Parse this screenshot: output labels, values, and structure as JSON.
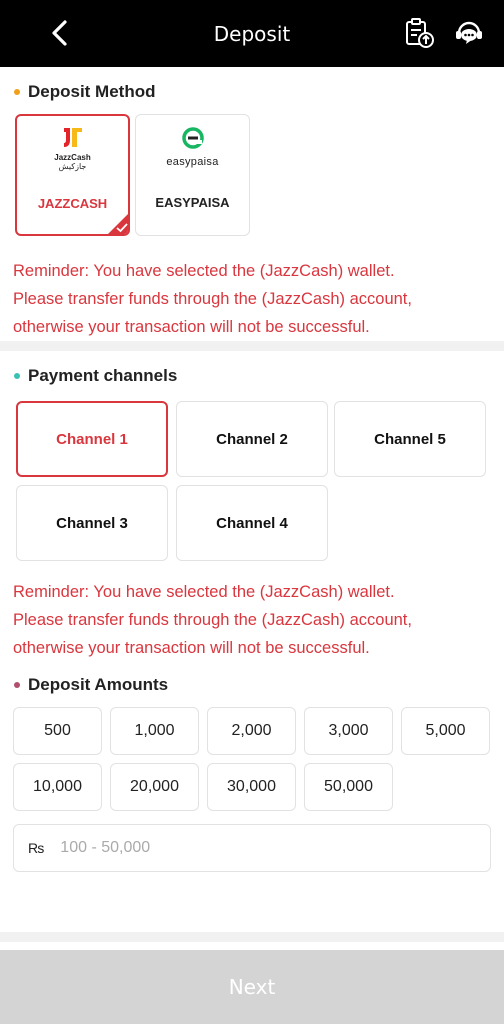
{
  "header": {
    "title": "Deposit"
  },
  "deposit_method": {
    "title": "Deposit Method",
    "dot_color": "#f0a019",
    "methods": [
      {
        "label": "JAZZCASH",
        "logo_text": "JazzCash",
        "logo_urdu": "جازکیش",
        "selected": true
      },
      {
        "label": "EASYPAISA",
        "logo_text": "easypaisa",
        "selected": false
      }
    ]
  },
  "reminder1": {
    "line1": "Reminder: You have selected the (JazzCash) wallet.",
    "line2": "Please transfer funds through the (JazzCash) account,",
    "line3": "otherwise your transaction will not be successful."
  },
  "payment_channels": {
    "title": "Payment channels",
    "dot_color": "#3cc0b4",
    "channels": [
      {
        "label": "Channel 1",
        "selected": true
      },
      {
        "label": "Channel 2",
        "selected": false
      },
      {
        "label": "Channel 5",
        "selected": false
      },
      {
        "label": "Channel 3",
        "selected": false
      },
      {
        "label": "Channel 4",
        "selected": false
      }
    ]
  },
  "reminder2": {
    "line1": "Reminder: You have selected the (JazzCash) wallet.",
    "line2": "Please transfer funds through the (JazzCash) account,",
    "line3": "otherwise your transaction will not be successful."
  },
  "deposit_amounts": {
    "title": "Deposit Amounts",
    "dot_color": "#b0506e",
    "amounts": [
      "500",
      "1,000",
      "2,000",
      "3,000",
      "5,000",
      "10,000",
      "20,000",
      "30,000",
      "50,000"
    ],
    "currency_symbol": "₨",
    "input_placeholder": "100 - 50,000",
    "input_value": ""
  },
  "next_button": {
    "label": "Next"
  },
  "colors": {
    "accent": "#d9363e",
    "header_bg": "#000000",
    "disabled_btn": "#d4d4d4"
  }
}
